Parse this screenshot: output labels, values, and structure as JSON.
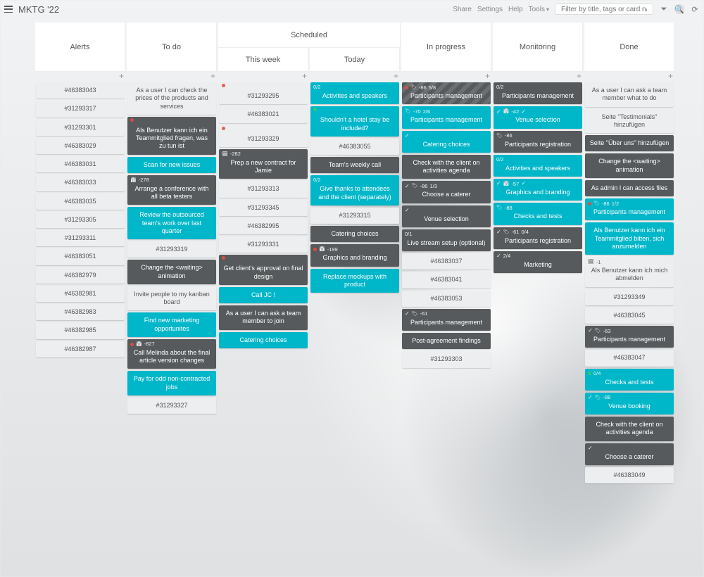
{
  "header": {
    "title": "MKTG '22",
    "links": [
      "Share",
      "Settings",
      "Help",
      "Tools"
    ],
    "search_placeholder": "Filter by title, tags or card name"
  },
  "columns": {
    "alerts": {
      "title": "Alerts",
      "cards": [
        {
          "style": "c-grey",
          "title": "#46383043"
        },
        {
          "style": "c-grey",
          "title": "#31293317"
        },
        {
          "style": "c-grey",
          "title": "#31293301"
        },
        {
          "style": "c-grey",
          "title": "#46383029"
        },
        {
          "style": "c-grey",
          "title": "#46383031"
        },
        {
          "style": "c-grey",
          "title": "#46383033"
        },
        {
          "style": "c-grey",
          "title": "#46383035"
        },
        {
          "style": "c-grey",
          "title": "#31293305"
        },
        {
          "style": "c-grey",
          "title": "#31293311"
        },
        {
          "style": "c-grey",
          "title": "#46383051"
        },
        {
          "style": "c-grey",
          "title": "#46382979"
        },
        {
          "style": "c-grey",
          "title": "#46382981"
        },
        {
          "style": "c-grey",
          "title": "#46382983"
        },
        {
          "style": "c-grey",
          "title": "#46382985"
        },
        {
          "style": "c-grey",
          "title": "#46382987"
        }
      ]
    },
    "todo": {
      "title": "To do",
      "cards": [
        {
          "style": "c-grey",
          "title": "As a user I can check the prices of the products and services"
        },
        {
          "style": "c-dark tall",
          "meta": [
            {
              "t": "dot"
            }
          ],
          "title": "Als Benutzer kann ich ein Teammitglied fragen, was zu tun ist"
        },
        {
          "style": "c-teal",
          "title": "Scan for new issues"
        },
        {
          "style": "c-dark tall",
          "meta": [
            {
              "t": "cal"
            },
            {
              "t": "txt",
              "v": "-278"
            }
          ],
          "title": "Arrange a conference with all beta testers"
        },
        {
          "style": "c-teal",
          "title": "Review the outsourced team's work over last quarter"
        },
        {
          "style": "c-grey",
          "title": "#31293319"
        },
        {
          "style": "c-dark",
          "title": "Change the <waiting> animation"
        },
        {
          "style": "c-grey",
          "title": "Invite people to my kanban board"
        },
        {
          "style": "c-teal",
          "title": "Find new marketing opportunites"
        },
        {
          "style": "c-dark tall",
          "meta": [
            {
              "t": "dot"
            },
            {
              "t": "cal"
            },
            {
              "t": "txt",
              "v": "-827"
            }
          ],
          "title": "Call Melinda about the final article version changes"
        },
        {
          "style": "c-teal",
          "title": "Pay for odd non-contracted jobs"
        },
        {
          "style": "c-grey",
          "title": "#31293327"
        }
      ]
    },
    "scheduled": {
      "title": "Scheduled"
    },
    "this_week": {
      "title": "This week",
      "cards": [
        {
          "style": "c-grey tall",
          "meta": [
            {
              "t": "dot"
            }
          ],
          "title": "#31293295"
        },
        {
          "style": "c-grey",
          "title": "#46383021"
        },
        {
          "style": "c-grey tall",
          "meta": [
            {
              "t": "dot"
            }
          ],
          "title": "#31293329"
        },
        {
          "style": "c-dark tall",
          "meta": [
            {
              "t": "cal-dark"
            },
            {
              "t": "txt",
              "v": "-282"
            }
          ],
          "title": "Prep a new contract for Jamie"
        },
        {
          "style": "c-grey",
          "title": "#31293313"
        },
        {
          "style": "c-grey",
          "title": "#31293345"
        },
        {
          "style": "c-grey",
          "title": "#46382995"
        },
        {
          "style": "c-grey",
          "title": "#31293331"
        },
        {
          "style": "c-dark tall",
          "meta": [
            {
              "t": "dot"
            }
          ],
          "title": "Get client's approval on final design"
        },
        {
          "style": "c-teal",
          "title": "Call JC !"
        },
        {
          "style": "c-dark",
          "title": "As a user I can ask a team member to join"
        },
        {
          "style": "c-teal",
          "title": "Catering choices"
        }
      ]
    },
    "today": {
      "title": "Today",
      "cards": [
        {
          "style": "c-teal tall",
          "meta": [
            {
              "t": "txt",
              "v": "0/2"
            }
          ],
          "title": "Activities and speakers"
        },
        {
          "style": "c-teal tall",
          "meta": [
            {
              "t": "dot green"
            }
          ],
          "title": "Shouldn't a hotel stay be included?"
        },
        {
          "style": "c-grey",
          "title": "#46383055"
        },
        {
          "style": "c-dark",
          "title": "Team's weekly call"
        },
        {
          "style": "c-teal tall",
          "meta": [
            {
              "t": "txt",
              "v": "0/2"
            }
          ],
          "title": "Give thanks to attendees and the client (separately)"
        },
        {
          "style": "c-grey",
          "title": "#31293315"
        },
        {
          "style": "c-dark",
          "title": "Catering choices"
        },
        {
          "style": "c-dark tall",
          "meta": [
            {
              "t": "dot"
            },
            {
              "t": "cal"
            },
            {
              "t": "txt",
              "v": "-199"
            }
          ],
          "title": "Graphics and branding"
        },
        {
          "style": "c-teal",
          "title": "Replace mockups with product"
        }
      ]
    },
    "in_progress": {
      "title": "In progress",
      "cards": [
        {
          "style": "c-hatch tall",
          "meta": [
            {
              "t": "dot"
            },
            {
              "t": "tag"
            },
            {
              "t": "txt",
              "v": "-86"
            },
            {
              "t": "txt",
              "v": "5/8"
            }
          ],
          "title": "Participants management"
        },
        {
          "style": "c-teal tall",
          "meta": [
            {
              "t": "tag"
            },
            {
              "t": "txt",
              "v": "-70"
            },
            {
              "t": "txt",
              "v": "2/6"
            }
          ],
          "title": "Participants management"
        },
        {
          "style": "c-teal tall",
          "meta": [
            {
              "t": "chk"
            }
          ],
          "title": "Catering choices"
        },
        {
          "style": "c-dark",
          "title": "Check with the client on activities agenda"
        },
        {
          "style": "c-dark tall",
          "meta": [
            {
              "t": "chk"
            },
            {
              "t": "tag"
            },
            {
              "t": "txt",
              "v": "-86"
            },
            {
              "t": "txt",
              "v": "1/3"
            }
          ],
          "title": "Choose a caterer"
        },
        {
          "style": "c-dark tall",
          "meta": [
            {
              "t": "chk"
            }
          ],
          "title": "Venue selection"
        },
        {
          "style": "c-dark tall",
          "meta": [
            {
              "t": "txt",
              "v": "0/1"
            }
          ],
          "title": "Live stream setup (optional)"
        },
        {
          "style": "c-grey",
          "title": "#46383037"
        },
        {
          "style": "c-grey",
          "title": "#46383041"
        },
        {
          "style": "c-grey",
          "title": "#46383053"
        },
        {
          "style": "c-dark tall",
          "meta": [
            {
              "t": "chk"
            },
            {
              "t": "tag"
            },
            {
              "t": "txt",
              "v": "-61"
            }
          ],
          "title": "Participants management"
        },
        {
          "style": "c-dark",
          "title": "Post-agreement findings"
        },
        {
          "style": "c-grey",
          "title": "#31293303"
        }
      ]
    },
    "monitoring": {
      "title": "Monitoring",
      "cards": [
        {
          "style": "c-dark tall",
          "meta": [
            {
              "t": "txt",
              "v": "0/2"
            }
          ],
          "title": "Participants management"
        },
        {
          "style": "c-teal tall",
          "meta": [
            {
              "t": "chk"
            },
            {
              "t": "cal"
            },
            {
              "t": "txt",
              "v": "-42"
            },
            {
              "t": "chk"
            }
          ],
          "title": "Venue selection"
        },
        {
          "style": "c-dark tall",
          "meta": [
            {
              "t": "tag"
            },
            {
              "t": "txt",
              "v": "-86"
            }
          ],
          "title": "Participants registration"
        },
        {
          "style": "c-teal tall",
          "meta": [
            {
              "t": "txt",
              "v": "0/2"
            }
          ],
          "title": "Activities and speakers"
        },
        {
          "style": "c-teal tall",
          "meta": [
            {
              "t": "chk"
            },
            {
              "t": "cal"
            },
            {
              "t": "txt",
              "v": "-57"
            },
            {
              "t": "chk"
            }
          ],
          "title": "Graphics and branding"
        },
        {
          "style": "c-teal tall",
          "meta": [
            {
              "t": "tag"
            },
            {
              "t": "txt",
              "v": "-88"
            }
          ],
          "title": "Checks and tests"
        },
        {
          "style": "c-dark tall",
          "meta": [
            {
              "t": "chk"
            },
            {
              "t": "tag"
            },
            {
              "t": "txt",
              "v": "-61"
            },
            {
              "t": "txt",
              "v": "0/4"
            }
          ],
          "title": "Participants registration"
        },
        {
          "style": "c-dark tall",
          "meta": [
            {
              "t": "chk"
            },
            {
              "t": "txt",
              "v": "2/4"
            }
          ],
          "title": "Marketing"
        }
      ]
    },
    "done": {
      "title": "Done",
      "cards": [
        {
          "style": "c-grey",
          "title": "As a user I can ask a team member what to do"
        },
        {
          "style": "c-grey",
          "title": "Seite \"Testimonials\" hinzufügen"
        },
        {
          "style": "c-dark",
          "title": "Seite \"Über uns\" hinzufügen"
        },
        {
          "style": "c-dark",
          "title": "Change the <waiting> animation"
        },
        {
          "style": "c-dark",
          "title": "As admin I can access files"
        },
        {
          "style": "c-teal tall",
          "meta": [
            {
              "t": "dot"
            },
            {
              "t": "tag"
            },
            {
              "t": "txt",
              "v": "-86"
            },
            {
              "t": "txt",
              "v": "1/2"
            }
          ],
          "title": "Participants management"
        },
        {
          "style": "c-teal",
          "title": "Als Benutzer kann ich ein Teammitglied bitten, sich anzumelden"
        },
        {
          "style": "c-grey tall",
          "meta": [
            {
              "t": "cal-dark"
            },
            {
              "t": "txt",
              "v": "-1"
            }
          ],
          "title": "Als Benutzer kann ich mich abmelden"
        },
        {
          "style": "c-grey",
          "title": "#31293349"
        },
        {
          "style": "c-grey",
          "title": "#46383045"
        },
        {
          "style": "c-dark tall",
          "meta": [
            {
              "t": "chk"
            },
            {
              "t": "tag"
            },
            {
              "t": "txt",
              "v": "-63"
            }
          ],
          "title": "Participants management"
        },
        {
          "style": "c-grey",
          "title": "#46383047"
        },
        {
          "style": "c-teal tall",
          "meta": [
            {
              "t": "dot green"
            },
            {
              "t": "txt",
              "v": "0/4"
            }
          ],
          "title": "Checks and tests"
        },
        {
          "style": "c-teal tall",
          "meta": [
            {
              "t": "chk"
            },
            {
              "t": "tag"
            },
            {
              "t": "txt",
              "v": "-88"
            }
          ],
          "title": "Venue booking"
        },
        {
          "style": "c-dark",
          "title": "Check with the client on activities agenda"
        },
        {
          "style": "c-dark tall",
          "meta": [
            {
              "t": "chk"
            }
          ],
          "title": "Choose a caterer"
        },
        {
          "style": "c-grey",
          "title": "#46383049"
        }
      ]
    }
  }
}
